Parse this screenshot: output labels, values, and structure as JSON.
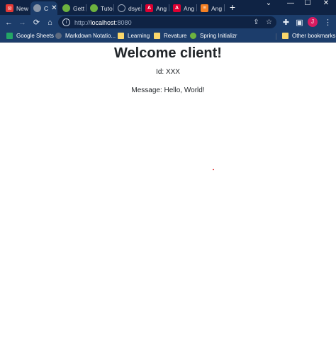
{
  "tabs": [
    {
      "label": "New",
      "icon": "tab-favicon-red",
      "color": "#e53935"
    },
    {
      "label": "C",
      "icon": "globe-icon",
      "color": "#8a96a8",
      "active": true
    },
    {
      "label": "Gett",
      "icon": "spring-icon",
      "color": "#6db33f"
    },
    {
      "label": "Tuto",
      "icon": "spring-icon",
      "color": "#6db33f"
    },
    {
      "label": "dsye",
      "icon": "github-icon",
      "color": "#24292e"
    },
    {
      "label": "Ang",
      "icon": "angular-icon",
      "color": "#dd0031"
    },
    {
      "label": "Ang",
      "icon": "angular-icon",
      "color": "#dd0031"
    },
    {
      "label": "Ang",
      "icon": "stackoverflow-icon",
      "color": "#f48024"
    }
  ],
  "toolbar": {
    "url_scheme": "http://",
    "url_host": "localhost",
    "url_port": ":8080",
    "avatar_letter": "J",
    "avatar_color": "#d81b60"
  },
  "bookmarks": {
    "items": [
      {
        "label": "Google Sheets",
        "icon": "sheets-icon"
      },
      {
        "label": "Markdown Notatio...",
        "icon": "globe-icon"
      },
      {
        "label": "Learning",
        "icon": "folder-icon"
      },
      {
        "label": "Revature",
        "icon": "folder-icon"
      },
      {
        "label": "Spring Initializr",
        "icon": "spring-icon"
      }
    ],
    "other": "Other bookmarks"
  },
  "page": {
    "title": "Welcome client!",
    "id_line": "Id: XXX",
    "message_line": "Message: Hello, World!"
  }
}
